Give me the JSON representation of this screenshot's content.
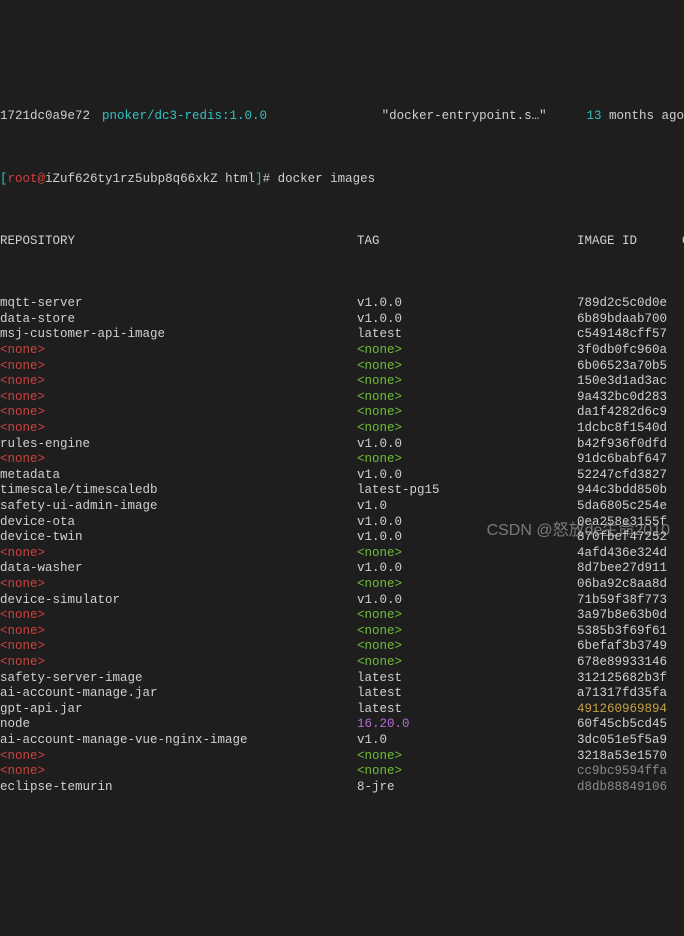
{
  "top": {
    "container_id": "1721dc0a9e72",
    "image_ref": "pnoker/dc3-redis:1.0.0",
    "command": "\"docker-entrypoint.s…\"",
    "age_num": "13",
    "age_unit": "months ago"
  },
  "prompt": {
    "open": "[",
    "user": "root",
    "sep": "@",
    "host": "iZuf626ty1rz5ubp8q66xkZ html",
    "close": "]",
    "hash": "#",
    "cmd": "docker images"
  },
  "headers": {
    "repo": "REPOSITORY",
    "tag": "TAG",
    "id": "IMAGE ID",
    "extra": "C"
  },
  "images": [
    {
      "repo": "mqtt-server",
      "tag": "v1.0.0",
      "id": "789d2c5c0d0e",
      "rc": "white",
      "tc": "white",
      "ic": "white"
    },
    {
      "repo": "data-store",
      "tag": "v1.0.0",
      "id": "6b89bdaab700",
      "rc": "white",
      "tc": "white",
      "ic": "white"
    },
    {
      "repo": "msj-customer-api-image",
      "tag": "latest",
      "id": "c549148cff57",
      "rc": "white",
      "tc": "white",
      "ic": "white"
    },
    {
      "repo": "<none>",
      "tag": "<none>",
      "id": "3f0db0fc960a",
      "rc": "red",
      "tc": "green",
      "ic": "white"
    },
    {
      "repo": "<none>",
      "tag": "<none>",
      "id": "6b06523a70b5",
      "rc": "red",
      "tc": "green",
      "ic": "white"
    },
    {
      "repo": "<none>",
      "tag": "<none>",
      "id": "150e3d1ad3ac",
      "rc": "red",
      "tc": "green",
      "ic": "white"
    },
    {
      "repo": "<none>",
      "tag": "<none>",
      "id": "9a432bc0d283",
      "rc": "red",
      "tc": "green",
      "ic": "white"
    },
    {
      "repo": "<none>",
      "tag": "<none>",
      "id": "da1f4282d6c9",
      "rc": "red",
      "tc": "green",
      "ic": "white"
    },
    {
      "repo": "<none>",
      "tag": "<none>",
      "id": "1dcbc8f1540d",
      "rc": "red",
      "tc": "green",
      "ic": "white"
    },
    {
      "repo": "rules-engine",
      "tag": "v1.0.0",
      "id": "b42f936f0dfd",
      "rc": "white",
      "tc": "white",
      "ic": "white"
    },
    {
      "repo": "<none>",
      "tag": "<none>",
      "id": "91dc6babf647",
      "rc": "red",
      "tc": "green",
      "ic": "white"
    },
    {
      "repo": "metadata",
      "tag": "v1.0.0",
      "id": "52247cfd3827",
      "rc": "white",
      "tc": "white",
      "ic": "white"
    },
    {
      "repo": "timescale/timescaledb",
      "tag": "latest-pg15",
      "id": "944c3bdd850b",
      "rc": "white",
      "tc": "white",
      "ic": "white"
    },
    {
      "repo": "safety-ui-admin-image",
      "tag": "v1.0",
      "id": "5da6805c254e",
      "rc": "white",
      "tc": "white",
      "ic": "white"
    },
    {
      "repo": "device-ota",
      "tag": "v1.0.0",
      "id": "0ea258e3155f",
      "rc": "white",
      "tc": "white",
      "ic": "white"
    },
    {
      "repo": "device-twin",
      "tag": "v1.0.0",
      "id": "870fbef47252",
      "rc": "white",
      "tc": "white",
      "ic": "white"
    },
    {
      "repo": "<none>",
      "tag": "<none>",
      "id": "4afd436e324d",
      "rc": "red",
      "tc": "green",
      "ic": "white"
    },
    {
      "repo": "data-washer",
      "tag": "v1.0.0",
      "id": "8d7bee27d911",
      "rc": "white",
      "tc": "white",
      "ic": "white"
    },
    {
      "repo": "<none>",
      "tag": "<none>",
      "id": "06ba92c8aa8d",
      "rc": "red",
      "tc": "green",
      "ic": "white"
    },
    {
      "repo": "device-simulator",
      "tag": "v1.0.0",
      "id": "71b59f38f773",
      "rc": "white",
      "tc": "white",
      "ic": "white"
    },
    {
      "repo": "<none>",
      "tag": "<none>",
      "id": "3a97b8e63b0d",
      "rc": "red",
      "tc": "green",
      "ic": "white"
    },
    {
      "repo": "<none>",
      "tag": "<none>",
      "id": "5385b3f69f61",
      "rc": "red",
      "tc": "green",
      "ic": "white"
    },
    {
      "repo": "<none>",
      "tag": "<none>",
      "id": "6befaf3b3749",
      "rc": "red",
      "tc": "green",
      "ic": "white"
    },
    {
      "repo": "<none>",
      "tag": "<none>",
      "id": "678e89933146",
      "rc": "red",
      "tc": "green",
      "ic": "white"
    },
    {
      "repo": "safety-server-image",
      "tag": "latest",
      "id": "312125682b3f",
      "rc": "white",
      "tc": "white",
      "ic": "white"
    },
    {
      "repo": "ai-account-manage.jar",
      "tag": "latest",
      "id": "a71317fd35fa",
      "rc": "white",
      "tc": "white",
      "ic": "white"
    },
    {
      "repo": "gpt-api.jar",
      "tag": "latest",
      "id": "491260969894",
      "rc": "white",
      "tc": "white",
      "ic": "yellow"
    },
    {
      "repo": "node",
      "tag": "16.20.0",
      "id": "60f45cb5cd45",
      "rc": "white",
      "tc": "magenta",
      "ic": "white"
    },
    {
      "repo": "ai-account-manage-vue-nginx-image",
      "tag": "v1.0",
      "id": "3dc051e5f5a9",
      "rc": "white",
      "tc": "white",
      "ic": "white"
    },
    {
      "repo": "<none>",
      "tag": "<none>",
      "id": "3218a53e1570",
      "rc": "red",
      "tc": "green",
      "ic": "white"
    },
    {
      "repo": "<none>",
      "tag": "<none>",
      "id": "cc9bc9594ffa",
      "rc": "red",
      "tc": "green",
      "ic": "dim"
    },
    {
      "repo": "eclipse-temurin",
      "tag": "8-jre",
      "id": "d8db88849106",
      "rc": "white",
      "tc": "white",
      "ic": "dim"
    }
  ],
  "watermark": "CSDN @怒放de生命2010"
}
